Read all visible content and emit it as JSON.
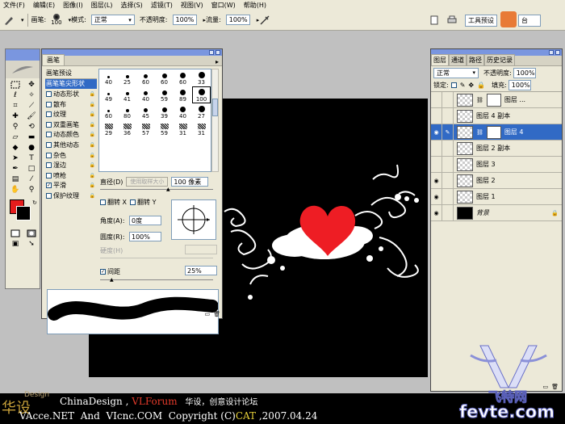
{
  "menu": [
    "文件(F)",
    "编辑(E)",
    "图像(I)",
    "图层(L)",
    "选择(S)",
    "滤镜(T)",
    "视图(V)",
    "窗口(W)",
    "帮助(H)"
  ],
  "options": {
    "brush_label": "画笔:",
    "brush_size": "100",
    "mode_label": "模式:",
    "mode_value": "正常",
    "opacity_label": "不透明度:",
    "opacity_value": "100%",
    "flow_label": "流量:",
    "flow_value": "100%",
    "tool_preset": "工具预设",
    "palette_tab": "台"
  },
  "brushes_panel": {
    "tab_label": "画笔",
    "side_items": [
      {
        "label": "画笔预设",
        "checkbox": false
      },
      {
        "label": "画笔笔尖形状",
        "checkbox": false
      },
      {
        "label": "动态形状",
        "checkbox": true,
        "checked": false
      },
      {
        "label": "散布",
        "checkbox": true,
        "checked": false
      },
      {
        "label": "纹理",
        "checkbox": true,
        "checked": false
      },
      {
        "label": "双重画笔",
        "checkbox": true,
        "checked": false
      },
      {
        "label": "动态颜色",
        "checkbox": true,
        "checked": false
      },
      {
        "label": "其他动态",
        "checkbox": true,
        "checked": false
      },
      {
        "label": "杂色",
        "checkbox": true,
        "checked": false
      },
      {
        "label": "湿边",
        "checkbox": true,
        "checked": false
      },
      {
        "label": "喷枪",
        "checkbox": true,
        "checked": false
      },
      {
        "label": "平滑",
        "checkbox": true,
        "checked": true
      },
      {
        "label": "保护纹理",
        "checkbox": true,
        "checked": false
      }
    ],
    "brush_sizes": [
      "40",
      "25",
      "60",
      "60",
      "60",
      "33",
      "49",
      "41",
      "40",
      "59",
      "89",
      "100",
      "60",
      "80",
      "45",
      "39",
      "40",
      "27",
      "29",
      "36",
      "57",
      "59",
      "31",
      "31"
    ],
    "diameter_label": "直径(D)",
    "use_sample_label": "使用取样大小",
    "diameter_value": "100 像素",
    "flip_x_label": "翻转 X",
    "flip_y_label": "翻转 Y",
    "angle_label": "角度(A):",
    "angle_value": "0度",
    "roundness_label": "圆度(R):",
    "roundness_value": "100%",
    "hardness_label": "硬度(H)",
    "spacing_label": "间距",
    "spacing_value": "25%",
    "spacing_checked": true
  },
  "layers_panel": {
    "tabs": [
      "图层",
      "通道",
      "路径",
      "历史记录"
    ],
    "blend_mode": "正常",
    "opacity_label": "不透明度:",
    "opacity_value": "100%",
    "lock_label": "锁定:",
    "fill_label": "填充:",
    "fill_value": "100%",
    "layers": [
      {
        "name": "图层 ...",
        "visible": false,
        "selected": false,
        "mask": true
      },
      {
        "name": "图层 4 副本",
        "visible": false,
        "selected": false,
        "mask": false
      },
      {
        "name": "图层 4",
        "visible": true,
        "selected": true,
        "mask": true
      },
      {
        "name": "图层 2 副本",
        "visible": false,
        "selected": false,
        "mask": false
      },
      {
        "name": "图层 3",
        "visible": false,
        "selected": false,
        "mask": false
      },
      {
        "name": "图层 2",
        "visible": true,
        "selected": false,
        "mask": false
      },
      {
        "name": "图层 1",
        "visible": true,
        "selected": false,
        "mask": false
      },
      {
        "name": "背景",
        "visible": true,
        "selected": false,
        "mask": false,
        "background": true
      }
    ]
  },
  "colors": {
    "foreground": "#e51c1c",
    "background": "#000000",
    "heart": "#ee1d24",
    "selection": "#316ac5"
  },
  "banner": {
    "site1": "ChinaDesign",
    "sep1": " , ",
    "site2": "VLForum",
    "tagline": "华设，创意设计论坛",
    "line2_a": "VAcce.NET  And  VIcnc.COM  Copyright (C)",
    "line2_cat": "CAT",
    "line2_date": " ,2007.04.24",
    "logo_text": "华设",
    "logo_sub": "Design"
  },
  "watermark": {
    "cn": "飞特网",
    "url": "fevte.com"
  }
}
